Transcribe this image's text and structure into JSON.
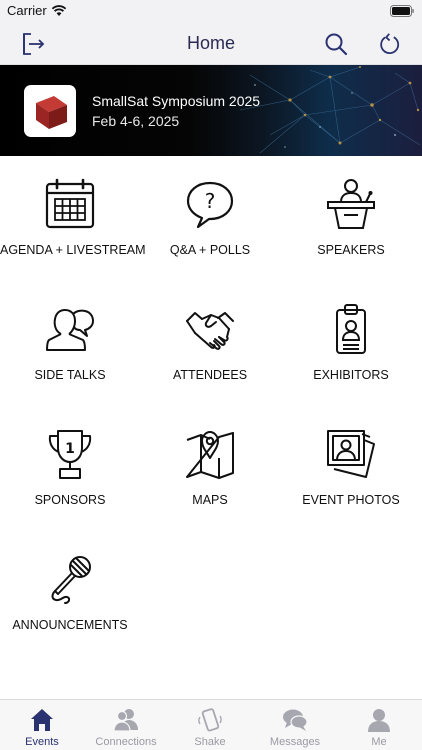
{
  "status_bar": {
    "carrier": "Carrier"
  },
  "nav": {
    "title": "Home",
    "exit_icon": "exit-icon",
    "search_icon": "search-icon",
    "refresh_icon": "refresh-icon"
  },
  "event": {
    "title": "SmallSat Symposium 2025",
    "dates": "Feb 4-6, 2025"
  },
  "tiles": [
    {
      "label": "AGENDA + LIVESTREAM",
      "icon": "calendar-icon"
    },
    {
      "label": "Q&A + POLLS",
      "icon": "question-bubble-icon"
    },
    {
      "label": "SPEAKERS",
      "icon": "podium-speaker-icon"
    },
    {
      "label": "SIDE TALKS",
      "icon": "people-chat-icon"
    },
    {
      "label": "ATTENDEES",
      "icon": "handshake-icon"
    },
    {
      "label": "EXHIBITORS",
      "icon": "badge-icon"
    },
    {
      "label": "SPONSORS",
      "icon": "trophy-icon"
    },
    {
      "label": "MAPS",
      "icon": "map-pin-icon"
    },
    {
      "label": "EVENT PHOTOS",
      "icon": "photos-icon"
    },
    {
      "label": "ANNOUNCEMENTS",
      "icon": "microphone-icon"
    }
  ],
  "tabs": [
    {
      "label": "Events",
      "icon": "home-icon",
      "active": true
    },
    {
      "label": "Connections",
      "icon": "connections-icon",
      "active": false
    },
    {
      "label": "Shake",
      "icon": "shake-phone-icon",
      "active": false
    },
    {
      "label": "Messages",
      "icon": "messages-icon",
      "active": false
    },
    {
      "label": "Me",
      "icon": "person-icon",
      "active": false
    }
  ],
  "colors": {
    "accent": "#2a3370",
    "nav_title": "#2a2a52",
    "tab_inactive": "#9a9aa4",
    "logo_red": "#b32a2a"
  }
}
